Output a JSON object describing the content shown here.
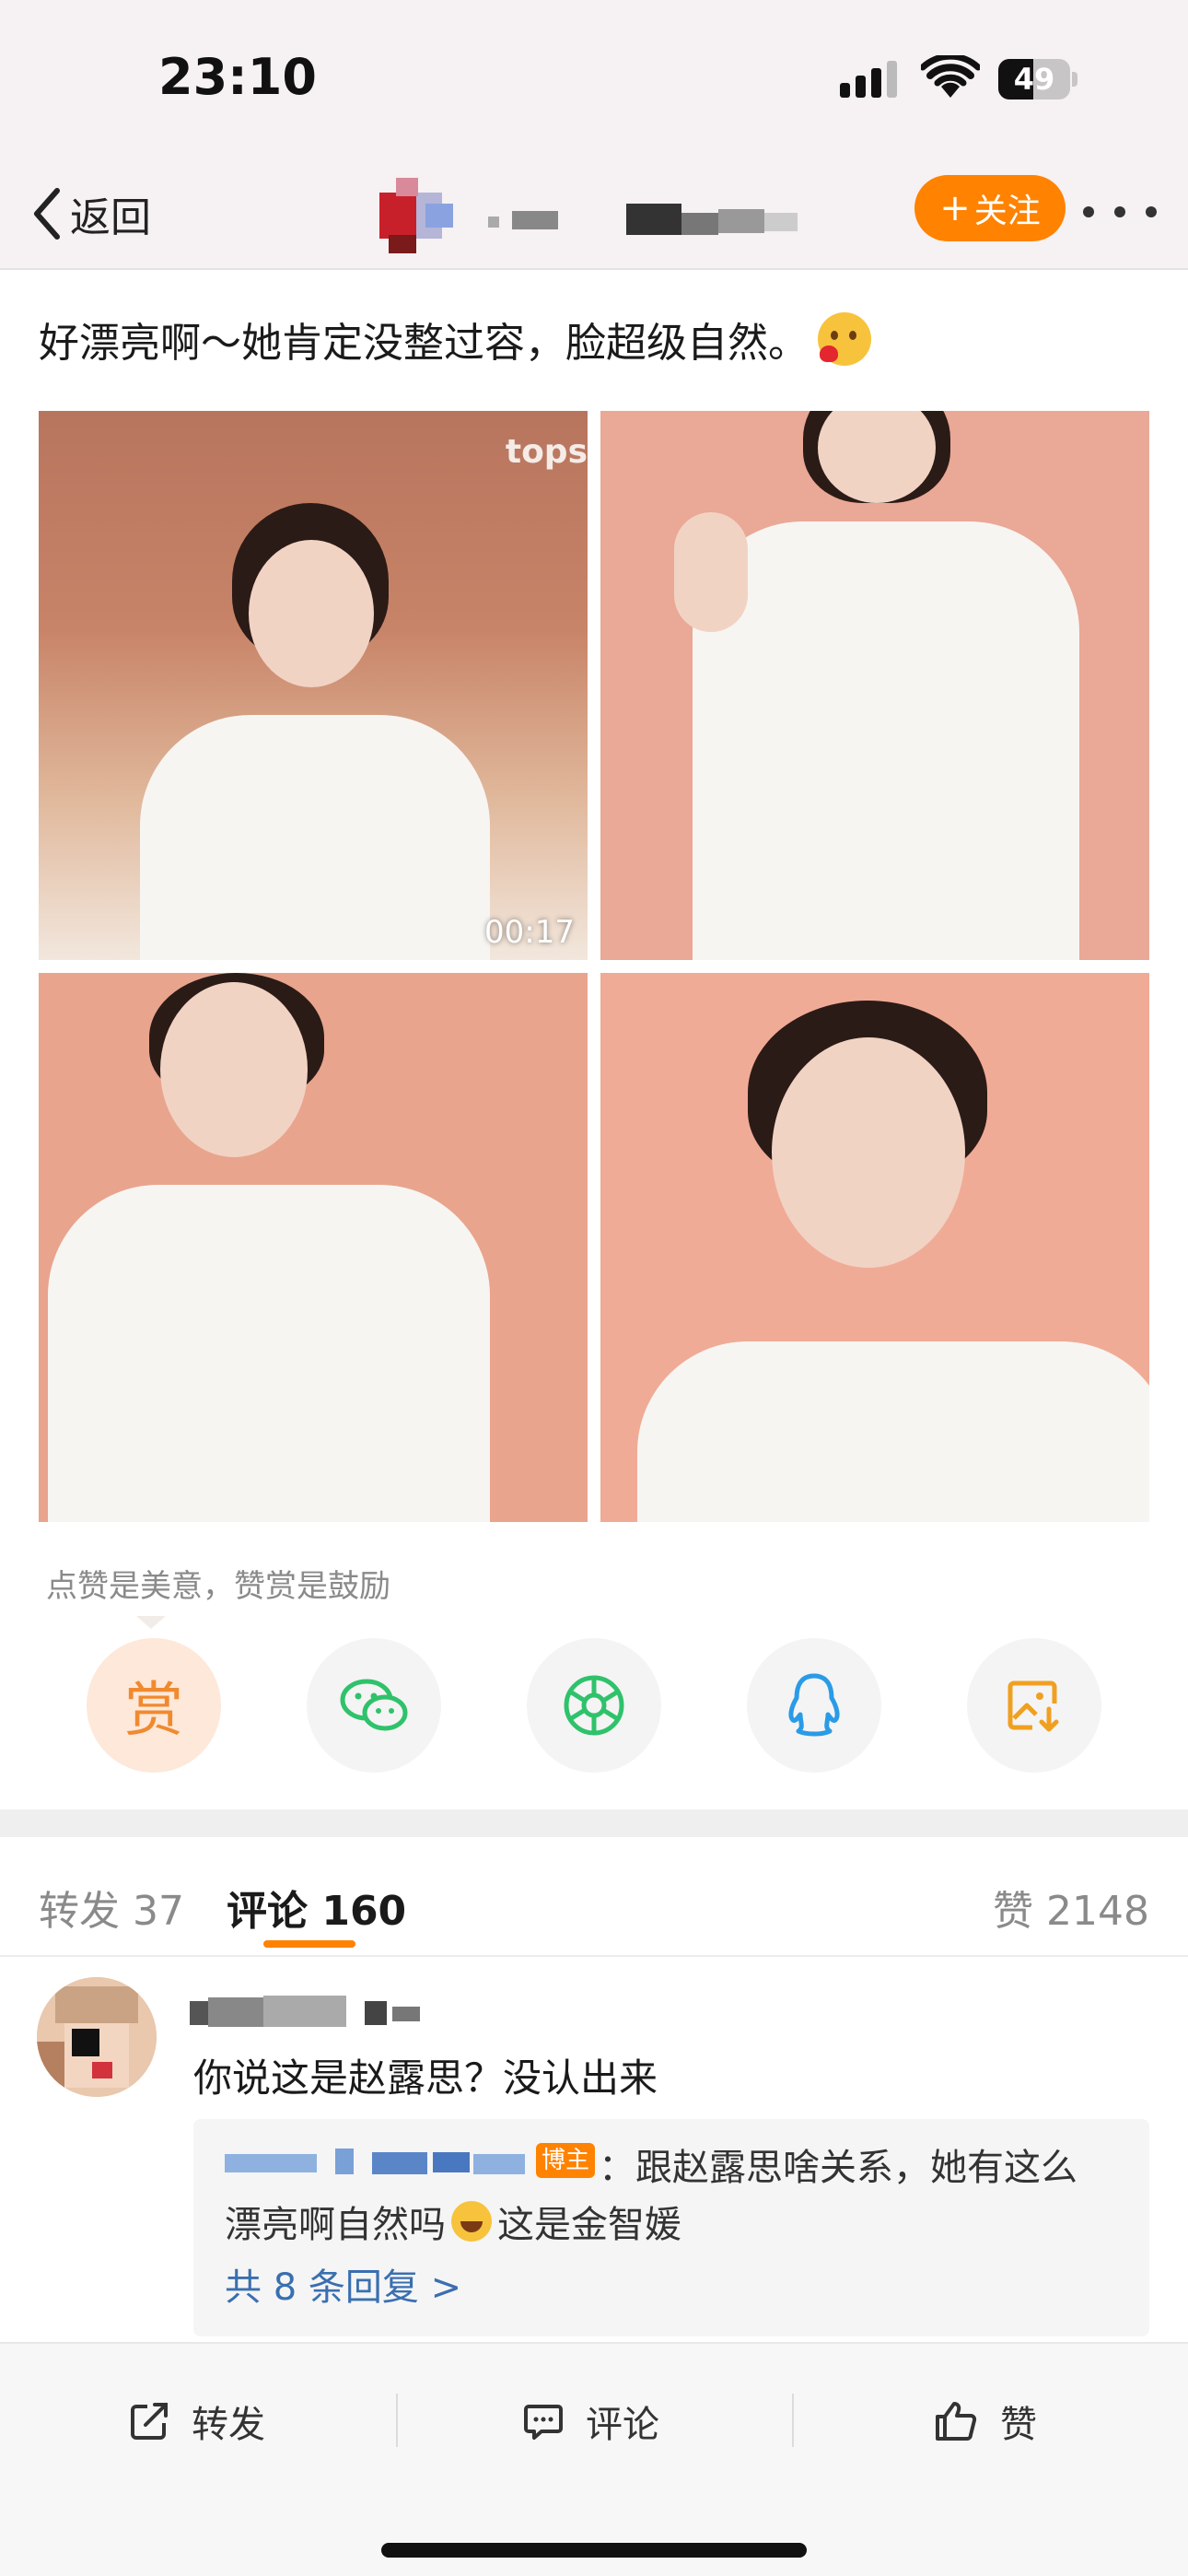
{
  "status_bar": {
    "time": "23:10",
    "battery": "49",
    "battery_level": 0.49
  },
  "nav": {
    "back_label": "返回",
    "follow_label": "关注",
    "follow_plus": "+"
  },
  "post": {
    "text": "好漂亮啊～她肯定没整过容，脸超级自然。",
    "emoji_icon": "blushing-heart-emoji",
    "photos": [
      {
        "video_duration": "00:17",
        "watermark": "tops"
      },
      {},
      {},
      {}
    ]
  },
  "reward": {
    "hint": "点赞是美意，赞赏是鼓励",
    "reward_label": "赏"
  },
  "tabs": {
    "repost_label": "转发",
    "repost_count": "37",
    "comment_label": "评论",
    "comment_count": "160",
    "like_label": "赞",
    "like_count": "2148"
  },
  "comment": {
    "text": "你说这是赵露思？没认出来",
    "reply": {
      "badge": "博主",
      "line1": "：跟赵露思啥关系，她有这么",
      "line2a": "漂亮啊自然吗",
      "line2b": "这是金智媛",
      "more": "共 8 条回复 >"
    }
  },
  "toolbar": {
    "repost": "转发",
    "comment": "评论",
    "like": "赞"
  },
  "colors": {
    "accent": "#ff8200",
    "link": "#3a6fb0",
    "wechat": "#2fc26b",
    "qq": "#2a9be6"
  }
}
